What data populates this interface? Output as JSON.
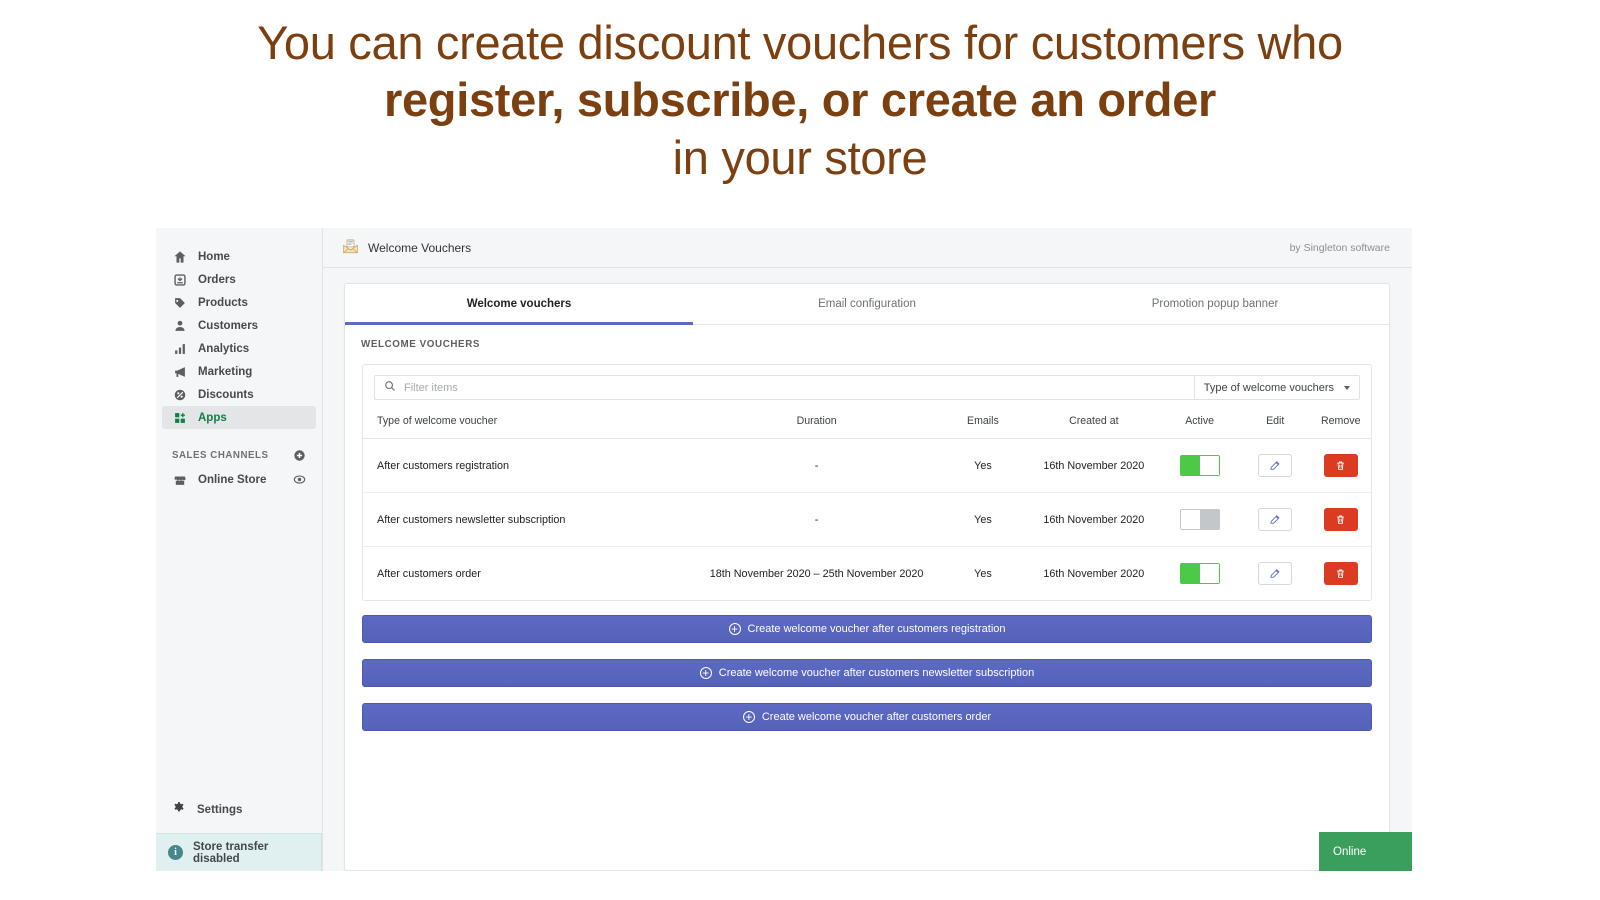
{
  "headline": {
    "line1": "You can create discount vouchers for customers who",
    "line2": "register, subscribe, or create an order",
    "line3": "in your store",
    "color": "#7B3F10"
  },
  "sidebar": {
    "items": [
      {
        "label": "Home",
        "icon": "home-icon",
        "active": false
      },
      {
        "label": "Orders",
        "icon": "orders-icon",
        "active": false
      },
      {
        "label": "Products",
        "icon": "products-tag-icon",
        "active": false
      },
      {
        "label": "Customers",
        "icon": "customers-person-icon",
        "active": false
      },
      {
        "label": "Analytics",
        "icon": "analytics-bars-icon",
        "active": false
      },
      {
        "label": "Marketing",
        "icon": "marketing-megaphone-icon",
        "active": false
      },
      {
        "label": "Discounts",
        "icon": "discounts-icon",
        "active": false
      },
      {
        "label": "Apps",
        "icon": "apps-grid-icon",
        "active": true
      }
    ],
    "sales_channels": {
      "title": "SALES CHANNELS",
      "add_icon": "plus-circle-icon",
      "channels": [
        {
          "label": "Online Store",
          "icon": "storefront-icon",
          "trailing_icon": "eye-icon"
        }
      ]
    },
    "settings": {
      "label": "Settings",
      "icon": "gear-icon"
    },
    "transfer_banner": {
      "label": "Store transfer disabled",
      "icon": "info-icon",
      "accent": "#47868B"
    }
  },
  "app_header": {
    "icon": "envelope-letter-icon",
    "title": "Welcome Vouchers",
    "byline": "by Singleton software"
  },
  "tabs": [
    {
      "label": "Welcome vouchers",
      "active": true
    },
    {
      "label": "Email configuration",
      "active": false
    },
    {
      "label": "Promotion popup banner",
      "active": false
    }
  ],
  "section_label": "WELCOME VOUCHERS",
  "filter": {
    "search_icon": "search-icon",
    "placeholder": "Filter items",
    "value": "",
    "select_label": "Type of welcome vouchers",
    "select_icon": "chevron-down-icon"
  },
  "table": {
    "columns": [
      "Type of welcome voucher",
      "Duration",
      "Emails",
      "Created at",
      "Active",
      "Edit",
      "Remove"
    ],
    "rows": [
      {
        "type": "After customers registration",
        "duration": "-",
        "emails": "Yes",
        "created_at": "16th November 2020",
        "active": true,
        "edit_icon": "pencil-icon",
        "remove_icon": "trash-icon"
      },
      {
        "type": "After customers newsletter subscription",
        "duration": "-",
        "emails": "Yes",
        "created_at": "16th November 2020",
        "active": false,
        "edit_icon": "pencil-icon",
        "remove_icon": "trash-icon"
      },
      {
        "type": "After customers order",
        "duration": "18th November 2020 – 25th November 2020",
        "emails": "Yes",
        "created_at": "16th November 2020",
        "active": true,
        "edit_icon": "pencil-icon",
        "remove_icon": "trash-icon"
      }
    ]
  },
  "actions": [
    {
      "label": "Create welcome voucher after customers registration",
      "icon": "plus-circle-icon"
    },
    {
      "label": "Create welcome voucher after customers newsletter subscription",
      "icon": "plus-circle-icon"
    },
    {
      "label": "Create welcome voucher after customers order",
      "icon": "plus-circle-icon"
    }
  ],
  "status_badge": {
    "label": "Online",
    "color": "#3A9E5D"
  }
}
